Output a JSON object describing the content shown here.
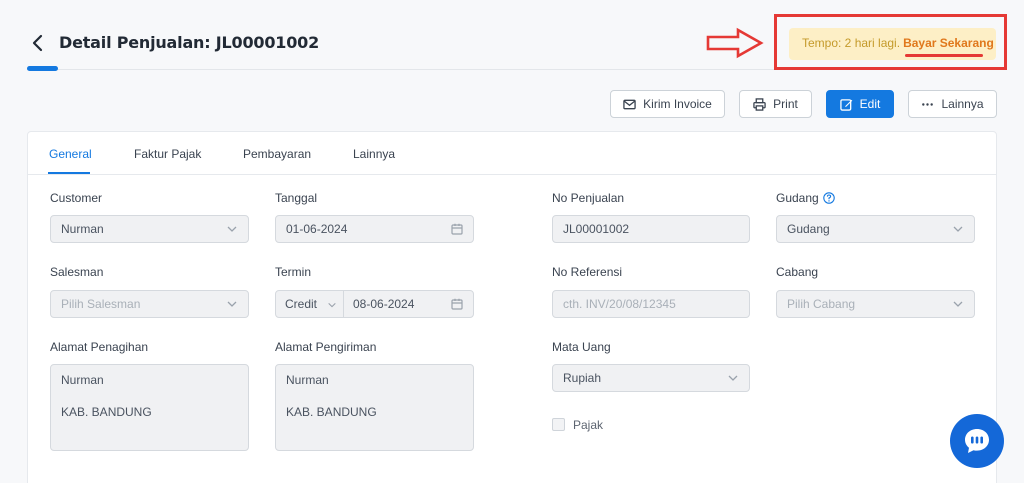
{
  "header": {
    "title": "Detail Penjualan: JL00001002"
  },
  "notice": {
    "text": "Tempo: 2 hari lagi.",
    "action": "Bayar Sekarang",
    "color_bg": "#fdefc6",
    "color_action": "#e0781c"
  },
  "toolbar": {
    "send_invoice": "Kirim Invoice",
    "print": "Print",
    "edit": "Edit",
    "more": "Lainnya",
    "accent": "#1479e0"
  },
  "tabs": [
    {
      "label": "General",
      "active": true
    },
    {
      "label": "Faktur Pajak",
      "active": false
    },
    {
      "label": "Pembayaran",
      "active": false
    },
    {
      "label": "Lainnya",
      "active": false
    }
  ],
  "form": {
    "customer": {
      "label": "Customer",
      "value": "Nurman"
    },
    "tanggal": {
      "label": "Tanggal",
      "value": "01-06-2024"
    },
    "no_penjualan": {
      "label": "No Penjualan",
      "value": "JL00001002"
    },
    "gudang": {
      "label": "Gudang",
      "value": "Gudang"
    },
    "salesman": {
      "label": "Salesman",
      "placeholder": "Pilih Salesman"
    },
    "termin": {
      "label": "Termin",
      "type": "Credit",
      "date": "08-06-2024"
    },
    "no_referensi": {
      "label": "No Referensi",
      "placeholder": "cth. INV/20/08/12345"
    },
    "cabang": {
      "label": "Cabang",
      "placeholder": "Pilih Cabang"
    },
    "alamat_penagihan": {
      "label": "Alamat Penagihan",
      "line1": "Nurman",
      "line2": "KAB. BANDUNG"
    },
    "alamat_pengiriman": {
      "label": "Alamat Pengiriman",
      "line1": "Nurman",
      "line2": "KAB. BANDUNG"
    },
    "mata_uang": {
      "label": "Mata Uang",
      "value": "Rupiah"
    },
    "pajak": {
      "label": "Pajak",
      "checked": false
    }
  }
}
